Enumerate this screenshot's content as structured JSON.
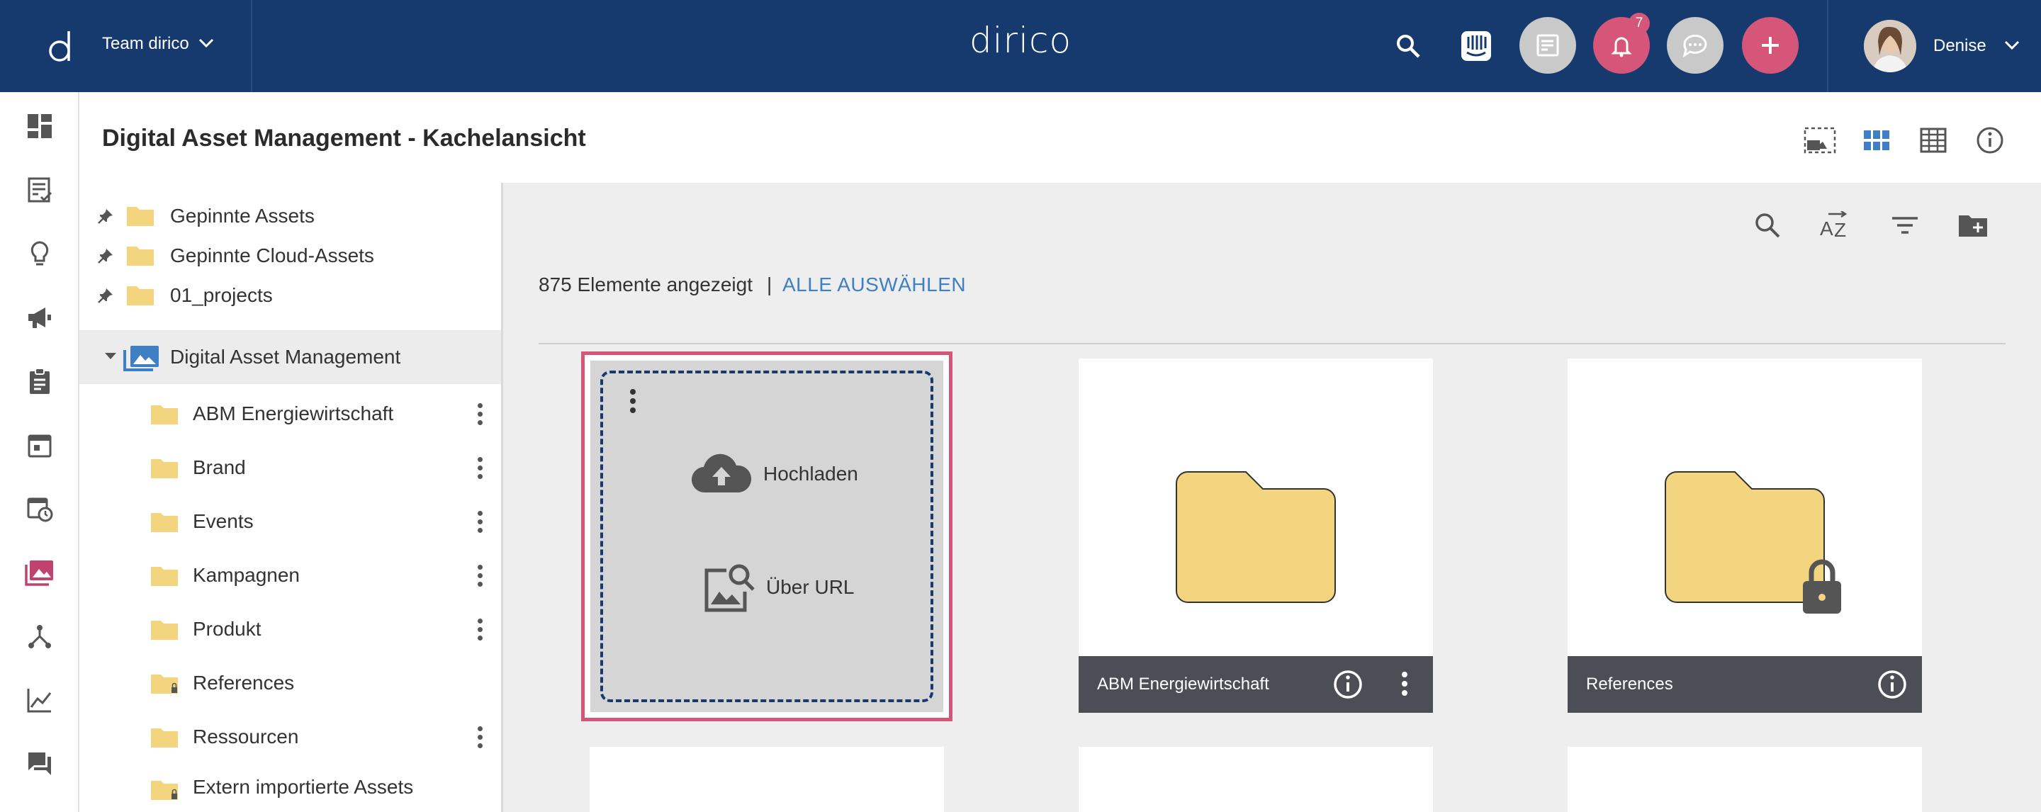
{
  "app": {
    "logo_letter": "d",
    "brand": "dirico",
    "team": "Team dirico",
    "notification_count": "7",
    "user_name": "Denise"
  },
  "colors": {
    "topbar": "#163a6e",
    "accent_red": "#d6567a",
    "link_blue": "#3f7fc4",
    "folder": "#f2d57e"
  },
  "page": {
    "title": "Digital Asset Management - Kachelansicht"
  },
  "tree": {
    "pinned": [
      {
        "label": "Gepinnte Assets"
      },
      {
        "label": "Gepinnte Cloud-Assets"
      },
      {
        "label": "01_projects"
      }
    ],
    "root": {
      "label": "Digital Asset Management"
    },
    "children": [
      {
        "label": "ABM Energiewirtschaft",
        "locked": false,
        "menu": true
      },
      {
        "label": "Brand",
        "locked": false,
        "menu": true
      },
      {
        "label": "Events",
        "locked": false,
        "menu": true
      },
      {
        "label": "Kampagnen",
        "locked": false,
        "menu": true
      },
      {
        "label": "Produkt",
        "locked": false,
        "menu": true
      },
      {
        "label": "References",
        "locked": true,
        "menu": false
      },
      {
        "label": "Ressourcen",
        "locked": false,
        "menu": true
      },
      {
        "label": "Extern importierte Assets",
        "locked": true,
        "menu": false
      }
    ]
  },
  "content": {
    "count_text": "875 Elemente angezeigt",
    "separator": "|",
    "select_all": "ALLE AUSWÄHLEN",
    "upload": {
      "upload_label": "Hochladen",
      "url_label": "Über URL"
    },
    "tiles": [
      {
        "label": "ABM Energiewirtschaft",
        "locked": false
      },
      {
        "label": "References",
        "locked": true
      }
    ]
  }
}
